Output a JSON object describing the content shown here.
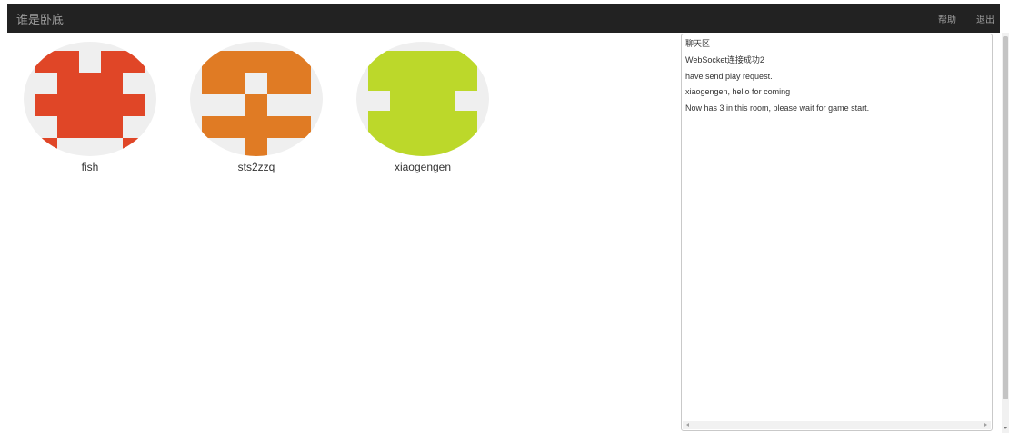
{
  "app": {
    "title": "谁是卧底"
  },
  "nav": {
    "help_label": "帮助",
    "logout_label": "退出"
  },
  "players": [
    {
      "name": "fish",
      "avatar_color": "#e04627",
      "avatar_icon": "identicon-avatar-icon"
    },
    {
      "name": "sts2zzq",
      "avatar_color": "#e07b24",
      "avatar_icon": "identicon-avatar-icon"
    },
    {
      "name": "xiaogengen",
      "avatar_color": "#bcd82a",
      "avatar_icon": "identicon-avatar-icon"
    }
  ],
  "chat": {
    "title": "聊天区",
    "messages": [
      "WebSocket连接成功2",
      "have send play request.",
      "xiaogengen, hello for coming",
      "Now has 3 in this room, please wait for game start."
    ]
  },
  "colors": {
    "navbar_bg": "#222222",
    "nav_text": "#9d9d9d",
    "avatar_bg": "#efefef"
  }
}
